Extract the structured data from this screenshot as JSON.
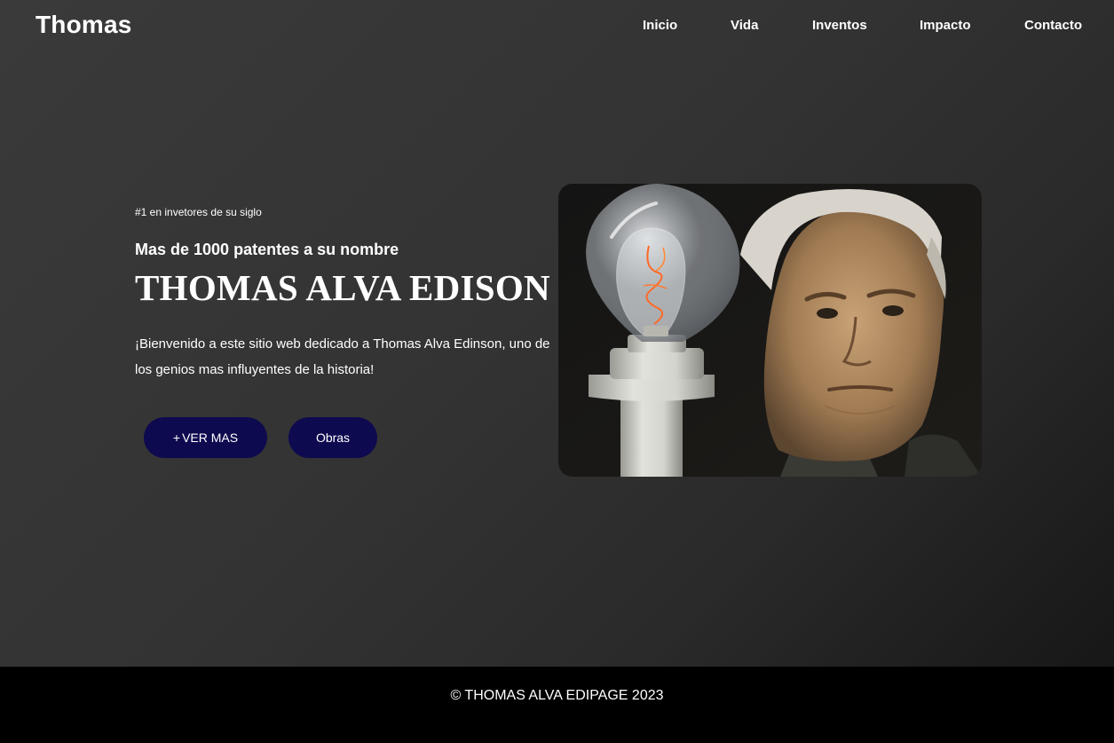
{
  "header": {
    "logo": "Thomas",
    "nav": [
      "Inicio",
      "Vida",
      "Inventos",
      "Impacto",
      "Contacto"
    ]
  },
  "hero": {
    "tagline": "#1 en invetores de su siglo",
    "subtitle": "Mas de 1000 patentes a su nombre",
    "title": "THOMAS ALVA EDISON",
    "description": "¡Bienvenido a este sitio web dedicado a Thomas Alva Edinson, uno de los genios mas influyentes de la historia!",
    "buttons": {
      "plus_icon": "+",
      "ver_mas": "VER MAS",
      "obras": "Obras"
    },
    "image": {
      "subject": "portrait-with-light-bulb"
    }
  },
  "footer": {
    "text": "© THOMAS ALVA EDIPAGE 2023"
  },
  "colors": {
    "button": "#0e0a4f",
    "footer": "#000000",
    "text": "#ffffff"
  }
}
